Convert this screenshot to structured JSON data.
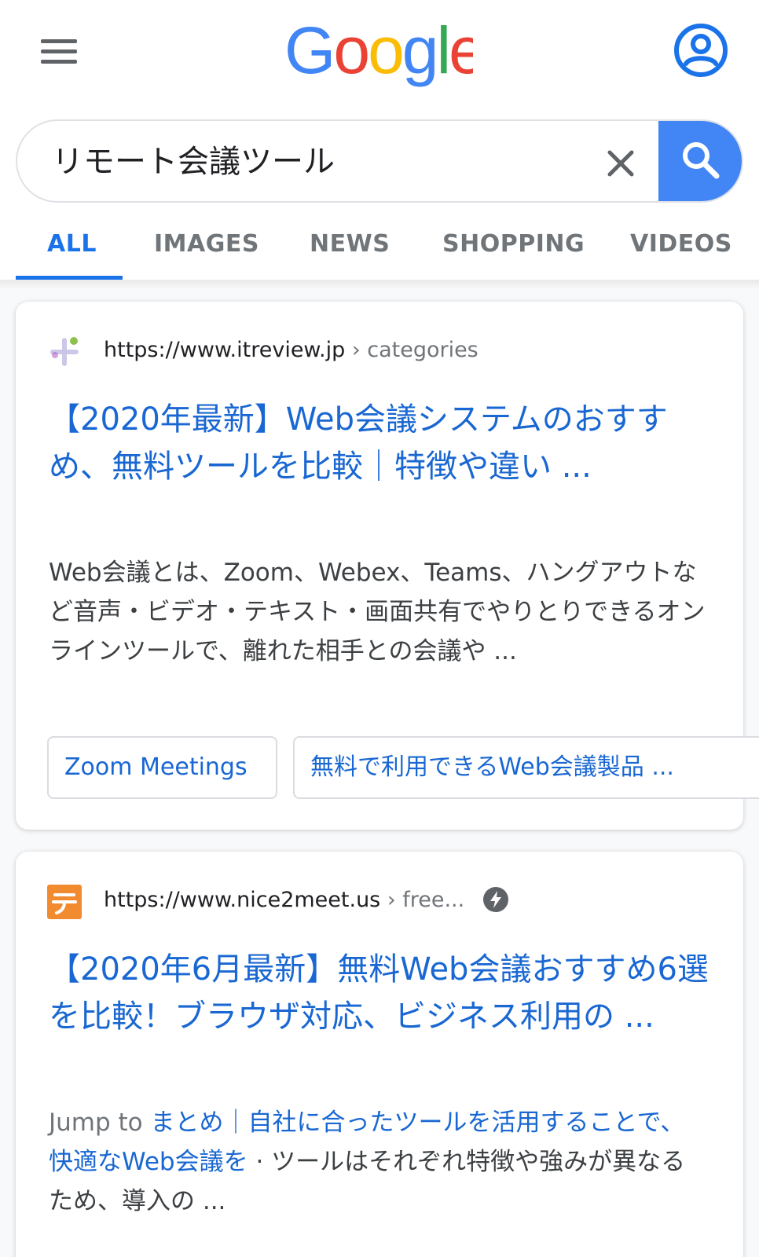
{
  "header": {
    "logo_text": "Google"
  },
  "search": {
    "query": "リモート会議ツール"
  },
  "tabs": [
    {
      "label": "ALL",
      "active": true
    },
    {
      "label": "IMAGES",
      "active": false
    },
    {
      "label": "NEWS",
      "active": false
    },
    {
      "label": "SHOPPING",
      "active": false
    },
    {
      "label": "VIDEOS",
      "active": false
    }
  ],
  "results": [
    {
      "url": "https://www.itreview.jp",
      "crumb": " › categories",
      "title": "【2020年最新】Web会議システムのおすすめ、無料ツールを比較｜特徴や違い ...",
      "snippet": "Web会議とは、Zoom、Webex、Teams、ハングアウトなど音声・ビデオ・テキスト・画面共有でやりとりできるオンラインツールで、離れた相手との会議や ...",
      "chips": [
        "Zoom Meetings",
        "無料で利用できるWeb会議製品 ..."
      ]
    },
    {
      "url": "https://www.nice2meet.us",
      "crumb": " › free...",
      "title": "【2020年6月最新】無料Web会議おすすめ6選を比較！ブラウザ対応、ビジネス利用の ...",
      "snippet_prefix": "Jump to ",
      "snippet_link": "まとめ｜自社に合ったツールを活用することで、快適なWeb会議を",
      "snippet_rest": " · ツールはそれぞれ特徴や強みが異なるため、導入の ..."
    }
  ],
  "colors": {
    "accent": "#1a73e8",
    "link": "#1967d2",
    "search_button": "#4285f4",
    "favicon2": "#f28b30"
  }
}
